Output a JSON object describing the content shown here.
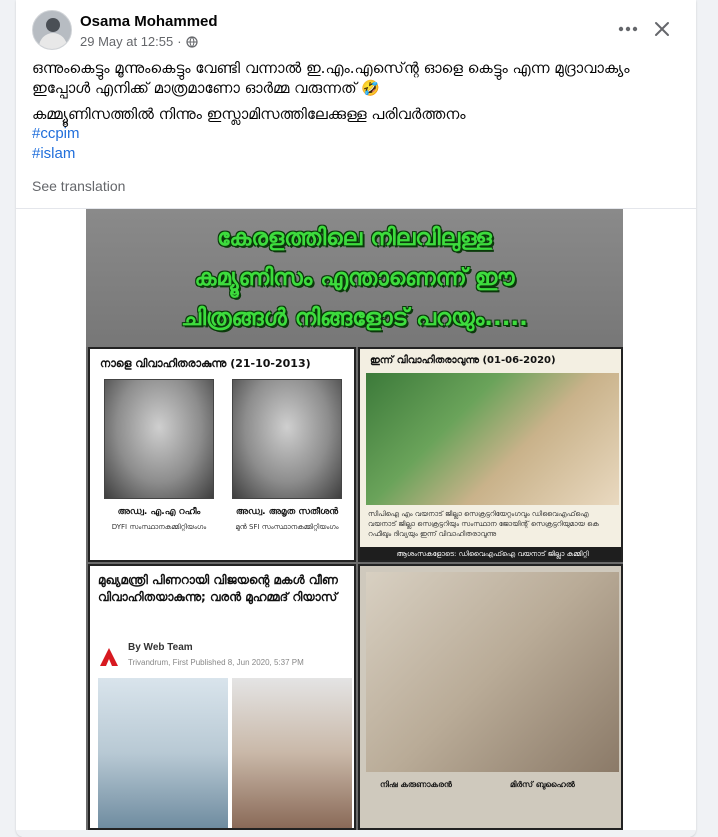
{
  "post": {
    "author": "Osama Mohammed",
    "timestamp": "29 May at 12:55",
    "separator": "·",
    "privacy_icon": "globe-icon",
    "more_icon": "more-dots-icon",
    "close_icon": "close-icon",
    "text_line1": "ഒന്നുംകെട്ടും മൂന്നുംകെട്ടും വേണ്ടി വന്നാൽ ഇ.എം.എസ്ന്റെ ഓളെ കെട്ടും എന്ന മുദ്രാവാക്യം ഇപ്പോൾ എനിക്ക് മാത്രമാണോ ഓർമ്മ വരുന്നത് 🤣",
    "text_line2": "കമ്മ്യൂണിസത്തിൽ നിന്നും ഇസ്ലാമിസത്തിലേക്കുള്ള പരിവർത്തനം",
    "hashtags": [
      "#ccpim",
      "#islam"
    ],
    "see_translation": "See translation"
  },
  "image": {
    "title_lines": [
      "കേരളത്തിലെ നിലവിലുള്ള",
      "കമ്യൂണിസം എന്താണെന്ന് ഈ",
      "ചിത്രങ്ങൾ നിങ്ങളോട് പറയും....."
    ],
    "top_left": {
      "title": "നാളെ വിവാഹിതരാകുന്നു (21-10-2013)",
      "left_name": "അഡ്വ. എ.എ റഹീം",
      "left_sub": "DYFI സംസ്ഥാനകമ്മിറ്റിയംഗം",
      "right_name": "അഡ്വ. അമൃത സതീശൻ",
      "right_sub": "മുൻ SFI സംസ്ഥാനകമ്മിറ്റിയംഗം"
    },
    "top_right": {
      "title": "ഇന്ന് വിവാഹിതരാവുന്നു (01-06-2020)",
      "description": "സിപിഐ എം വയനാട് ജില്ലാ സെക്രട്ടറിയേറ്റംഗവും ഡിവൈഎഫ്ഐ വയനാട് ജില്ലാ സെക്രട്ടറിയും സംസ്ഥാന ജോയിന്റ് സെക്രട്ടറിയുമായ കെ റഫീഖും ദിവ്യയും ഇന്ന് വിവാഹിതരാവുന്നു",
      "footer": "ആശംസകളോടെ: ഡിവൈഎഫ്ഐ വയനാട് ജില്ലാ കമ്മിറ്റി"
    },
    "bottom_left": {
      "headline": "മുഖ്യമന്ത്രി പിണറായി വിജയന്റെ മകൾ വീണ വിവാഹിതയാകുന്നു; വരൻ മുഹമ്മദ് റിയാസ്",
      "byline": "By Web Team",
      "dateline": "Trivandrum, First Published 8, Jun 2020, 5:37 PM"
    },
    "bottom_right": {
      "left_name": "നിഷ കരുണാകരൻ",
      "right_name": "മിർസ് ബുഹൈൽ"
    }
  }
}
